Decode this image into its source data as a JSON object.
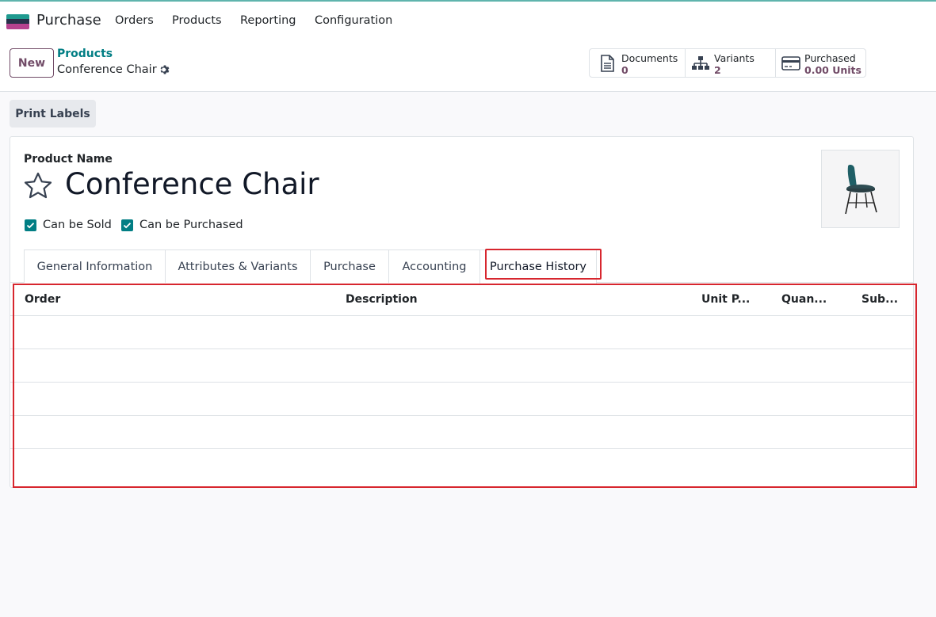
{
  "navbar": {
    "app_name": "Purchase",
    "menu": [
      "Orders",
      "Products",
      "Reporting",
      "Configuration"
    ]
  },
  "control": {
    "new_label": "New",
    "breadcrumb_parent": "Products",
    "breadcrumb_current": "Conference Chair",
    "stats": [
      {
        "label": "Documents",
        "value": "0",
        "icon": "document-icon"
      },
      {
        "label": "Variants",
        "value": "2",
        "icon": "sitemap-icon"
      },
      {
        "label": "Purchased",
        "value": "0.00 Units",
        "icon": "credit-card-icon"
      }
    ]
  },
  "actions": {
    "print_labels": "Print Labels"
  },
  "form": {
    "product_name_label": "Product Name",
    "product_name": "Conference Chair",
    "can_be_sold": "Can be Sold",
    "can_be_purchased": "Can be Purchased",
    "tabs": [
      "General Information",
      "Attributes & Variants",
      "Purchase",
      "Accounting",
      "Purchase History"
    ],
    "active_tab": "Purchase History"
  },
  "table": {
    "columns": [
      "Order",
      "Description",
      "Unit P...",
      "Quan...",
      "Sub..."
    ],
    "rows": []
  },
  "colors": {
    "brand": "#714b67",
    "teal": "#017e84",
    "highlight": "#d7262e"
  }
}
